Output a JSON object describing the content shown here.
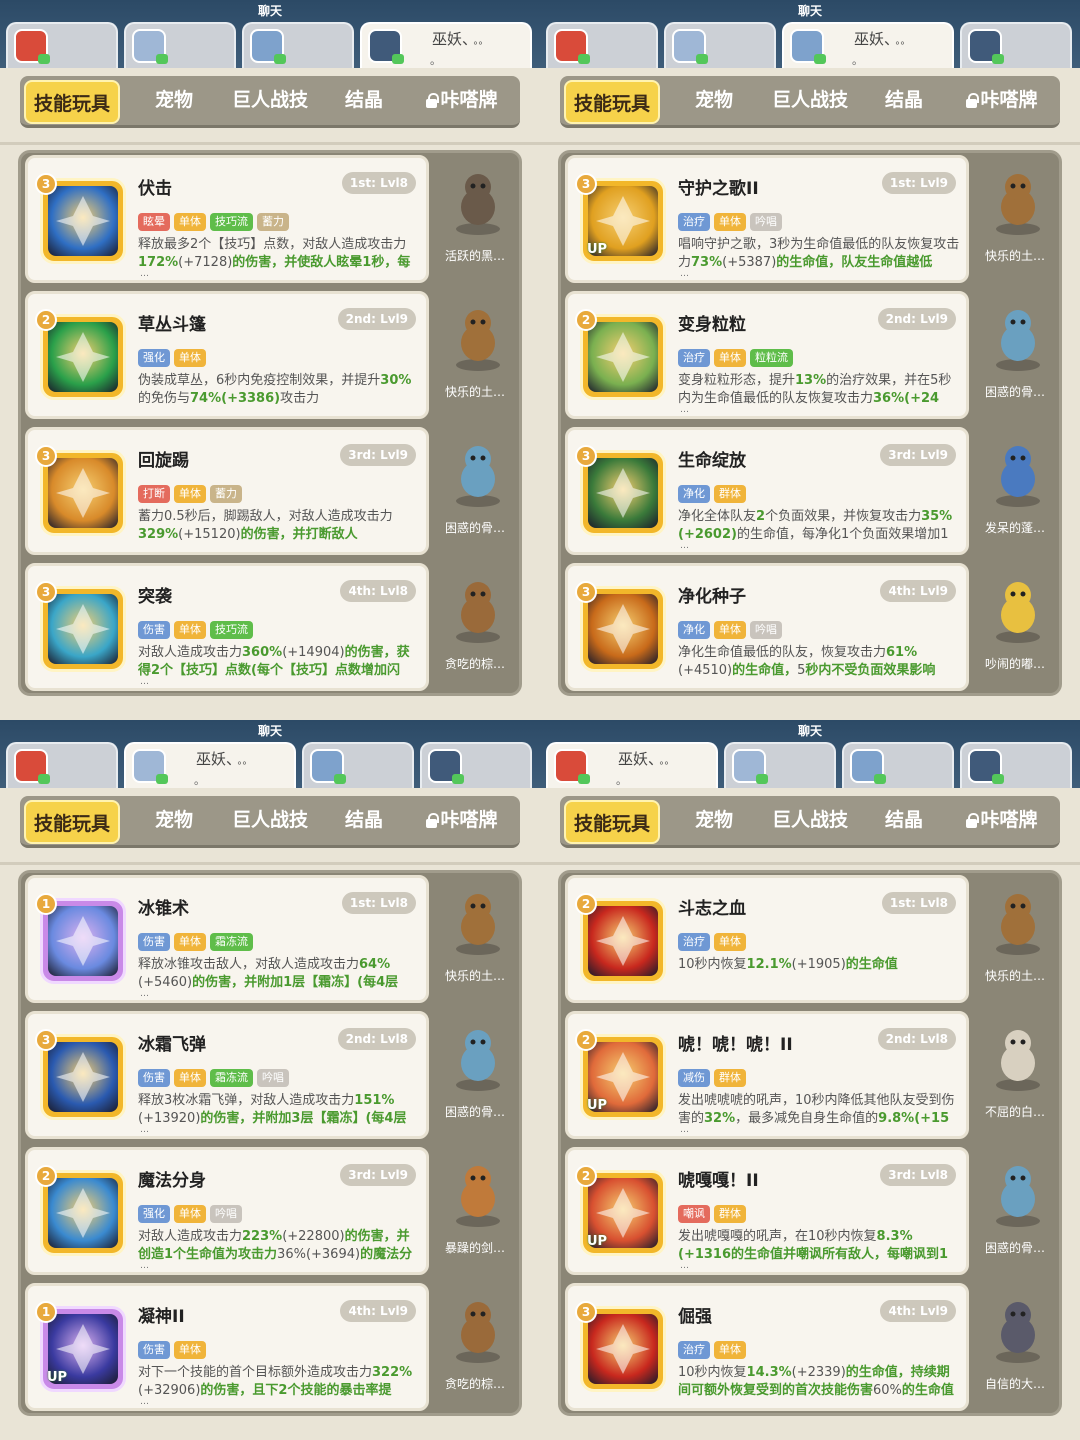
{
  "tag_colors": {
    "眩晕": "#e46b5d",
    "打断": "#e46b5d",
    "嘲讽": "#e46b5d",
    "单体": "#f0b43a",
    "群体": "#f0b43a",
    "技巧流": "#5fbd4a",
    "霜冻流": "#5fbd4a",
    "粒粒流": "#5fbd4a",
    "蓄力": "#c9b48a",
    "吟唱": "#c9c4bd",
    "强化": "#6f98d4",
    "伤害": "#6f98d4",
    "治疗": "#6f98d4",
    "净化": "#6f98d4",
    "减伤": "#6f98d4"
  },
  "screens": [
    {
      "chat": "聊天",
      "player_tabs": [
        {
          "avatar_color": "#d94b3a"
        },
        {
          "avatar_color": "#9fb7d6"
        },
        {
          "avatar_color": "#7ea2cc"
        },
        {
          "avatar_color": "#405a7a",
          "name": "巫妖、",
          "sub": "。。",
          "dot": "。"
        }
      ],
      "active_tab": 3,
      "nav": [
        "技能玩具",
        "宠物",
        "巨人战技",
        "结晶",
        "咔嗒牌"
      ],
      "cards": [
        {
          "name": "伏击",
          "slot": "1st: Lvl8",
          "level": "3",
          "tags": [
            "眩晕",
            "单体",
            "技巧流",
            "蓄力"
          ],
          "desc": [
            "释放最多2个【技巧】点数，对敌人造成攻击力",
            "172%",
            "(+7128)",
            "的伤害，并使敌人眩晕1秒，每"
          ],
          "more": "…",
          "icon": "#2f6fc4",
          "up": "",
          "pet": "活跃的黑…",
          "pet_color": "#6a5a4a"
        },
        {
          "name": "草丛斗篷",
          "slot": "2nd: Lvl9",
          "level": "2",
          "tags": [
            "强化",
            "单体"
          ],
          "desc": [
            "伪装成草丛，6秒内免疫控制效果，并提升",
            "30%",
            "的免伤与",
            "74%(+3386)",
            "攻击力"
          ],
          "more": "",
          "icon": "#2aa04a",
          "up": "",
          "pet": "快乐的土…",
          "pet_color": "#a0703a"
        },
        {
          "name": "回旋踢",
          "slot": "3rd: Lvl9",
          "level": "3",
          "tags": [
            "打断",
            "单体",
            "蓄力"
          ],
          "desc": [
            "蓄力0.5秒后，脚踢敌人，对敌人造成攻击力",
            "329%",
            "(+15120)",
            "的伤害，并打断敌人"
          ],
          "more": "",
          "icon": "#d88a2a",
          "up": "",
          "pet": "困惑的骨…",
          "pet_color": "#6aa0c0"
        },
        {
          "name": "突袭",
          "slot": "4th: Lvl8",
          "level": "3",
          "tags": [
            "伤害",
            "单体",
            "技巧流"
          ],
          "desc": [
            "对敌人造成攻击力",
            "360%",
            "(+14904)",
            "的伤害，获得2个【技巧】点数(每个【技巧】点数增加闪"
          ],
          "more": "…",
          "icon": "#3aa6c8",
          "up": "",
          "pet": "贪吃的棕…",
          "pet_color": "#9a6a3a"
        }
      ]
    },
    {
      "chat": "聊天",
      "player_tabs": [
        {
          "avatar_color": "#d94b3a"
        },
        {
          "avatar_color": "#9fb7d6"
        },
        {
          "avatar_color": "#7ea2cc",
          "name": "巫妖、",
          "sub": "。。",
          "dot": "。"
        },
        {
          "avatar_color": "#405a7a"
        }
      ],
      "active_tab": 2,
      "nav": [
        "技能玩具",
        "宠物",
        "巨人战技",
        "结晶",
        "咔嗒牌"
      ],
      "cards": [
        {
          "name": "守护之歌II",
          "slot": "1st: Lvl9",
          "level": "3",
          "tags": [
            "治疗",
            "单体",
            "吟唱"
          ],
          "desc": [
            "唱响守护之歌，3秒为生命值最低的队友恢复攻击力",
            "73%",
            "(+5387)",
            "的生命值，队友生命值越低"
          ],
          "more": "…",
          "icon": "#e0a020",
          "up": "UP",
          "pet": "快乐的土…",
          "pet_color": "#a0703a"
        },
        {
          "name": "变身粒粒",
          "slot": "2nd: Lvl9",
          "level": "2",
          "tags": [
            "治疗",
            "单体",
            "粒粒流"
          ],
          "desc": [
            "变身粒粒形态，提升",
            "13%",
            "的治疗效果，并在5秒内为生命值最低的队友恢复攻击力",
            "36%(+24"
          ],
          "more": "…",
          "icon": "#7ab050",
          "up": "",
          "pet": "困惑的骨…",
          "pet_color": "#6aa0c0"
        },
        {
          "name": "生命绽放",
          "slot": "3rd: Lvl9",
          "level": "3",
          "tags": [
            "净化",
            "群体"
          ],
          "desc": [
            "净化全体队友",
            "2",
            "个负面效果，并恢复攻击力",
            "35%(+2602)",
            "的生命值，每净化1个负面效果增加1"
          ],
          "more": "…",
          "icon": "#3a7a3a",
          "up": "",
          "pet": "发呆的蓬…",
          "pet_color": "#4a7ac0"
        },
        {
          "name": "净化种子",
          "slot": "4th: Lvl9",
          "level": "3",
          "tags": [
            "净化",
            "单体",
            "吟唱"
          ],
          "desc": [
            "净化生命值最低的队友，恢复攻击力",
            "61%",
            "(+4510)",
            "的生命值，",
            "5",
            "秒内不受负面效果影响"
          ],
          "more": "",
          "icon": "#c86a1a",
          "up": "",
          "pet": "吵闹的嘟…",
          "pet_color": "#e8c040"
        }
      ]
    },
    {
      "chat": "聊天",
      "player_tabs": [
        {
          "avatar_color": "#d94b3a"
        },
        {
          "avatar_color": "#9fb7d6",
          "name": "巫妖、",
          "sub": "。。",
          "dot": "。"
        },
        {
          "avatar_color": "#7ea2cc"
        },
        {
          "avatar_color": "#405a7a"
        }
      ],
      "active_tab": 1,
      "nav": [
        "技能玩具",
        "宠物",
        "巨人战技",
        "结晶",
        "咔嗒牌"
      ],
      "cards": [
        {
          "name": "冰锥术",
          "slot": "1st: Lvl8",
          "level": "1",
          "tags": [
            "伤害",
            "单体",
            "霜冻流"
          ],
          "desc": [
            "释放冰锥攻击敌人，对敌人造成攻击力",
            "64%",
            "(+5460)",
            "的伤害，并附加1层【霜冻】(每4层【霜"
          ],
          "more": "…",
          "icon": "#6a8ae0",
          "up": "",
          "pet": "快乐的土…",
          "pet_color": "#a0703a",
          "purple": true
        },
        {
          "name": "冰霜飞弹",
          "slot": "2nd: Lvl8",
          "level": "3",
          "tags": [
            "伤害",
            "单体",
            "霜冻流",
            "吟唱"
          ],
          "desc": [
            "释放3枚冰霜飞弹，对敌人造成攻击力",
            "151%",
            "(+13920)",
            "的伤害，并附加3层【霜冻】(每4层【霜"
          ],
          "more": "…",
          "icon": "#2a5ab0",
          "up": "",
          "pet": "困惑的骨…",
          "pet_color": "#6aa0c0"
        },
        {
          "name": "魔法分身",
          "slot": "3rd: Lvl9",
          "level": "2",
          "tags": [
            "强化",
            "单体",
            "吟唱"
          ],
          "desc": [
            "对敌人造成攻击力",
            "223%",
            "(+22800)",
            "的伤害，并创造1个生命值为攻击力",
            "36%(+3694)",
            "的魔法分"
          ],
          "more": "…",
          "icon": "#3a8ad0",
          "up": "",
          "pet": "暴躁的剑…",
          "pet_color": "#c07a3a"
        },
        {
          "name": "凝神II",
          "slot": "4th: Lvl9",
          "level": "1",
          "tags": [
            "伤害",
            "单体"
          ],
          "desc": [
            "对下一个技能的首个目标额外造成攻击力",
            "322%",
            "(+32906)",
            "的伤害，且下2个技能的暴击率提"
          ],
          "more": "…",
          "icon": "#3a3aa0",
          "up": "UP",
          "pet": "贪吃的棕…",
          "pet_color": "#9a6a3a",
          "purple": true
        }
      ]
    },
    {
      "chat": "聊天",
      "player_tabs": [
        {
          "avatar_color": "#d94b3a",
          "name": "巫妖、",
          "sub": "。。",
          "dot": "。"
        },
        {
          "avatar_color": "#9fb7d6"
        },
        {
          "avatar_color": "#7ea2cc"
        },
        {
          "avatar_color": "#405a7a"
        }
      ],
      "active_tab": 0,
      "nav": [
        "技能玩具",
        "宠物",
        "巨人战技",
        "结晶",
        "咔嗒牌"
      ],
      "cards": [
        {
          "name": "斗志之血",
          "slot": "1st: Lvl8",
          "level": "2",
          "tags": [
            "治疗",
            "单体"
          ],
          "desc": [
            "10秒内恢复",
            "12.1%",
            "(+1905)",
            "的生命值"
          ],
          "more": "",
          "icon": "#c8281e",
          "up": "",
          "pet": "快乐的土…",
          "pet_color": "#a0703a"
        },
        {
          "name": "唬！唬！唬！II",
          "slot": "2nd: Lvl8",
          "level": "2",
          "tags": [
            "减伤",
            "群体"
          ],
          "desc": [
            "发出唬唬唬的吼声，10秒内降低其他队友受到伤害的",
            "32%",
            "，最多减免自身生命值的",
            "9.8%(+15"
          ],
          "more": "…",
          "icon": "#e06a3a",
          "up": "UP",
          "pet": "不屈的白…",
          "pet_color": "#d8d0c0"
        },
        {
          "name": "唬嘎嘎！II",
          "slot": "3rd: Lvl8",
          "level": "2",
          "tags": [
            "嘲讽",
            "群体"
          ],
          "desc": [
            "发出唬嘎嘎的吼声，在10秒内恢复",
            "8.3%(+1316",
            "",
            "的生命值并嘲讽所有敌人，每嘲讽到1个敌人"
          ],
          "more": "…",
          "icon": "#d85030",
          "up": "UP",
          "pet": "困惑的骨…",
          "pet_color": "#6aa0c0"
        },
        {
          "name": "倔强",
          "slot": "4th: Lvl9",
          "level": "3",
          "tags": [
            "治疗",
            "单体"
          ],
          "desc": [
            "10秒内恢复",
            "14.3%",
            "(+2339)",
            "的生命值，持续期间可额外恢复受到的首次技能伤害",
            "60%",
            "的生命值"
          ],
          "more": "",
          "icon": "#c8281e",
          "up": "",
          "pet": "自信的大…",
          "pet_color": "#5a5a6a"
        }
      ]
    }
  ]
}
